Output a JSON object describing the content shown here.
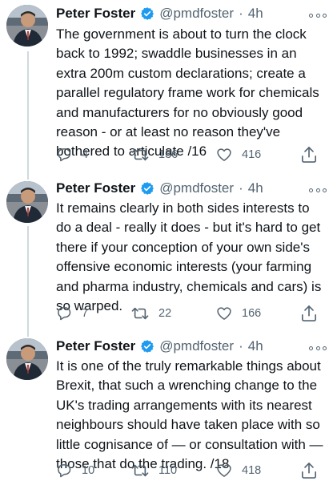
{
  "tweets": [
    {
      "author": "Peter Foster",
      "handle": "@pmdfoster",
      "separator": "·",
      "time": "4h",
      "text": "The government is about to turn the clock back to 1992; swaddle businesses in an extra 200m custom declarations; create a parallel regulatory frame work for chemicals and manufacturers for no obviously good reason - or at least no reason they've bothered to articulate /16",
      "replies": "4",
      "retweets": "136",
      "likes": "416"
    },
    {
      "author": "Peter Foster",
      "handle": "@pmdfoster",
      "separator": "·",
      "time": "4h",
      "text": "It remains clearly in both sides interests to do a deal - really it does - but it's hard to get there if your conception of your own side's offensive economic interests (your farming and pharma industry, chemicals and cars) is so warped.",
      "replies": "7",
      "retweets": "22",
      "likes": "166"
    },
    {
      "author": "Peter Foster",
      "handle": "@pmdfoster",
      "separator": "·",
      "time": "4h",
      "text": "It is one of the truly remarkable things about Brexit, that such a wrenching change to the UK's trading arrangements with its nearest neighbours should have taken place with so little cognisance of — or consultation with — those that do the trading. /18",
      "replies": "10",
      "retweets": "110",
      "likes": "418"
    }
  ],
  "icons": {
    "verified": "verified-badge-icon",
    "more": "more-options-icon",
    "reply": "reply-icon",
    "retweet": "retweet-icon",
    "like": "heart-icon",
    "share": "share-icon"
  },
  "colors": {
    "text": "#0f1419",
    "secondary": "#536471",
    "verified": "#1d9bf0",
    "thread_line": "#cfd9de"
  }
}
